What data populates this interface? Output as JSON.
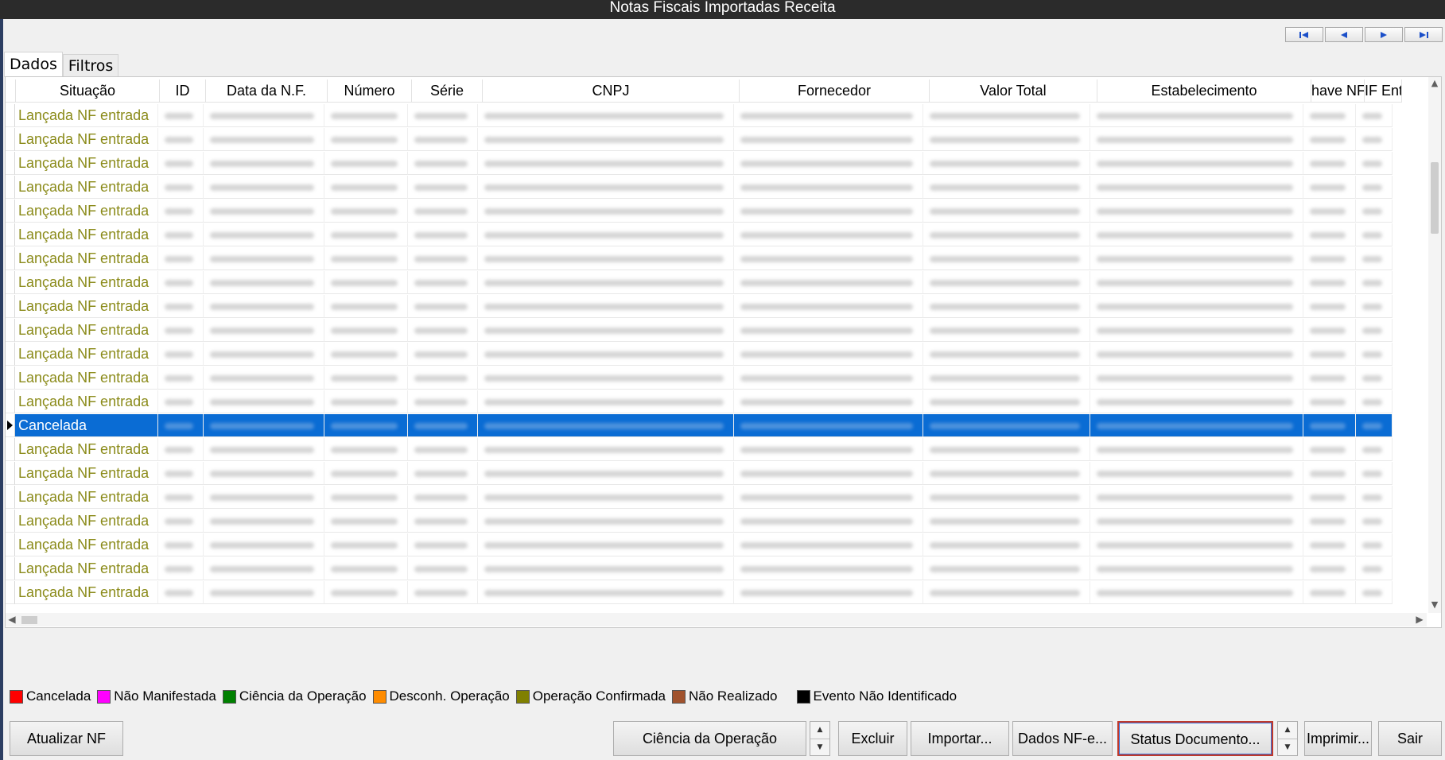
{
  "window": {
    "title": "Notas Fiscais Importadas Receita"
  },
  "tabs": [
    {
      "label": "Dados"
    },
    {
      "label": "Filtros"
    }
  ],
  "grid": {
    "columns": [
      {
        "label": "Situação"
      },
      {
        "label": "ID"
      },
      {
        "label": "Data da N.F."
      },
      {
        "label": "Número"
      },
      {
        "label": "Série"
      },
      {
        "label": "CNPJ"
      },
      {
        "label": "Fornecedor"
      },
      {
        "label": "Valor Total"
      },
      {
        "label": "Estabelecimento"
      },
      {
        "label": "have NF"
      },
      {
        "label": "IF Ent"
      }
    ],
    "selected_index": 13,
    "rows": [
      {
        "situacao": "Lançada NF entrada"
      },
      {
        "situacao": "Lançada NF entrada"
      },
      {
        "situacao": "Lançada NF entrada"
      },
      {
        "situacao": "Lançada NF entrada"
      },
      {
        "situacao": "Lançada NF entrada"
      },
      {
        "situacao": "Lançada NF entrada"
      },
      {
        "situacao": "Lançada NF entrada"
      },
      {
        "situacao": "Lançada NF entrada"
      },
      {
        "situacao": "Lançada NF entrada"
      },
      {
        "situacao": "Lançada NF entrada"
      },
      {
        "situacao": "Lançada NF entrada"
      },
      {
        "situacao": "Lançada NF entrada"
      },
      {
        "situacao": "Lançada NF entrada"
      },
      {
        "situacao": "Cancelada"
      },
      {
        "situacao": "Lançada NF entrada"
      },
      {
        "situacao": "Lançada NF entrada"
      },
      {
        "situacao": "Lançada NF entrada"
      },
      {
        "situacao": "Lançada NF entrada"
      },
      {
        "situacao": "Lançada NF entrada"
      },
      {
        "situacao": "Lançada NF entrada"
      },
      {
        "situacao": "Lançada NF entrada"
      }
    ]
  },
  "legend": [
    {
      "label": "Cancelada",
      "color": "#ff0000"
    },
    {
      "label": "Não Manifestada",
      "color": "#ff00ff"
    },
    {
      "label": "Ciência da Operação",
      "color": "#008000"
    },
    {
      "label": "Desconh. Operação",
      "color": "#ff8c00"
    },
    {
      "label": "Operação Confirmada",
      "color": "#808000"
    },
    {
      "label": "Não Realizado",
      "color": "#a0522d"
    },
    {
      "label": "Evento Não Identificado",
      "color": "#000000"
    }
  ],
  "buttons": {
    "atualizar_nf": "Atualizar NF",
    "ciencia_operacao": "Ciência da Operação",
    "excluir": "Excluir",
    "importar": "Importar...",
    "dados_nfe": "Dados NF-e...",
    "status_documento": "Status Documento...",
    "imprimir": "Imprimir...",
    "sair": "Sair"
  },
  "colors": {
    "situacao_text": "#8b8b1a",
    "selection": "#0a6cd4",
    "title_bar": "#2b2b2b"
  }
}
